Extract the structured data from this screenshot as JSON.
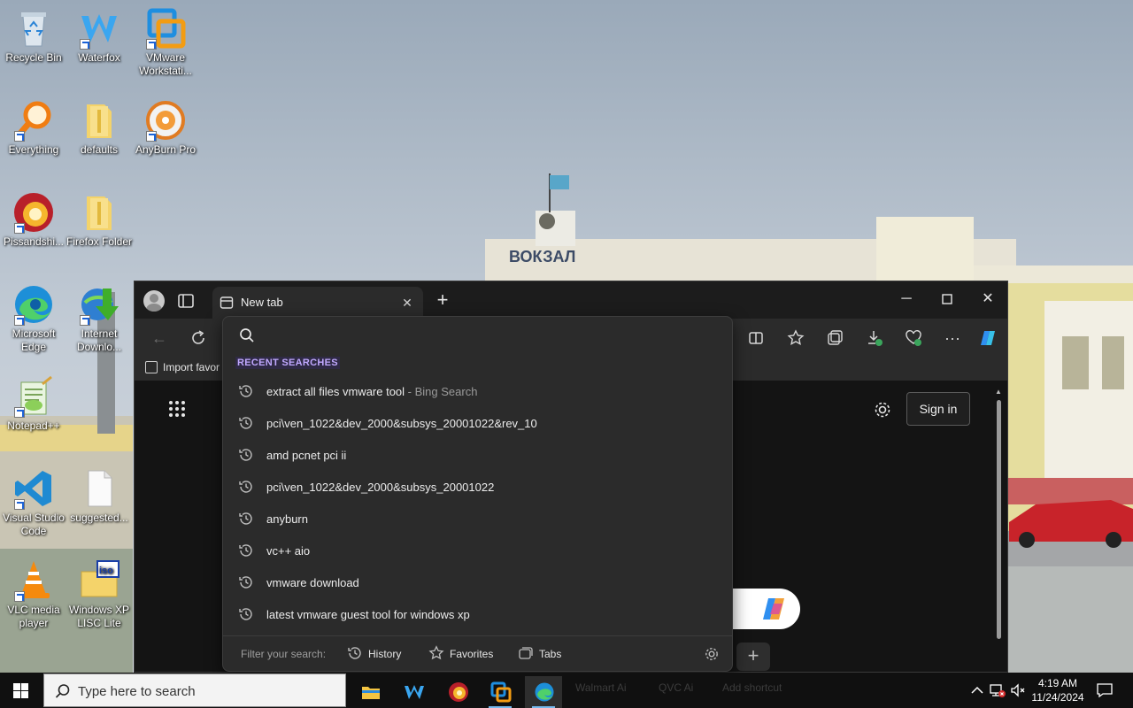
{
  "desktop": {
    "icons": [
      {
        "label": "Recycle Bin",
        "icon": "recycle-bin-icon"
      },
      {
        "label": "Waterfox",
        "icon": "waterfox-icon"
      },
      {
        "label": "VMware Workstati...",
        "icon": "vmware-icon"
      },
      {
        "label": "Everything",
        "icon": "everything-search-icon"
      },
      {
        "label": "defaults",
        "icon": "folder-icon"
      },
      {
        "label": "AnyBurn Pro",
        "icon": "anyburn-disc-icon"
      },
      {
        "label": "Pissandshi...",
        "icon": "chromium-browser-icon"
      },
      {
        "label": "Firefox Folder",
        "icon": "folder-icon"
      },
      {
        "label": "Microsoft Edge",
        "icon": "edge-icon"
      },
      {
        "label": "Internet Downlo...",
        "icon": "internet-download-manager-icon"
      },
      {
        "label": "Notepad++",
        "icon": "notepad-plus-plus-icon"
      },
      {
        "label": "Visual Studio Code",
        "icon": "vscode-icon"
      },
      {
        "label": "suggested...",
        "icon": "text-file-icon"
      },
      {
        "label": "VLC media player",
        "icon": "vlc-icon"
      },
      {
        "label": "Windows XP LISC Lite",
        "icon": "iso-file-icon"
      }
    ]
  },
  "browser": {
    "tab_title": "New tab",
    "favorites_bar": {
      "import_label": "Import favor"
    },
    "page": {
      "sign_in_label": "Sign in"
    }
  },
  "omnibox": {
    "query": "",
    "recent_label": "RECENT SEARCHES",
    "suggestions": [
      {
        "text": "extract all files vmware tool",
        "source": " - Bing Search"
      },
      {
        "text": "pci\\ven_1022&dev_2000&subsys_20001022&rev_10",
        "source": ""
      },
      {
        "text": "amd pcnet pci ii",
        "source": ""
      },
      {
        "text": "pci\\ven_1022&dev_2000&subsys_20001022",
        "source": ""
      },
      {
        "text": "anyburn",
        "source": ""
      },
      {
        "text": "vc++ aio",
        "source": ""
      },
      {
        "text": "vmware download",
        "source": ""
      },
      {
        "text": "latest vmware guest tool for windows xp",
        "source": ""
      }
    ],
    "filter_label": "Filter your search:",
    "filters": {
      "history": "History",
      "favorites": "Favorites",
      "tabs": "Tabs"
    }
  },
  "taskbar": {
    "search_placeholder": "Type here to search",
    "ghost_labels": {
      "walmart": "Walmart Ai",
      "qvc": "QVC Ai",
      "add": "Add shortcut"
    },
    "clock": {
      "time": "4:19 AM",
      "date": "11/24/2024"
    }
  },
  "colors": {
    "accent": "#c0a8ff",
    "browser_bg": "#2b2b2b",
    "taskbar": "#101010"
  }
}
